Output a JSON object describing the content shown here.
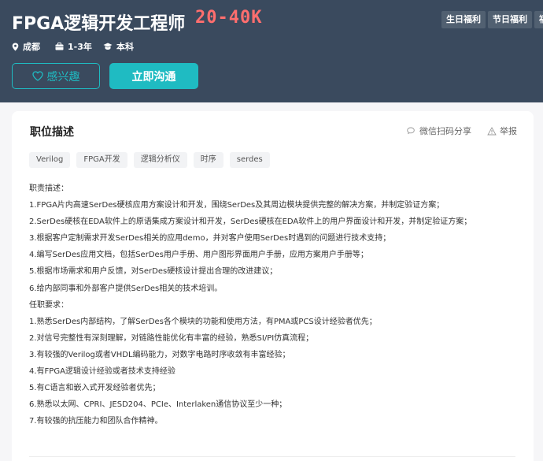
{
  "job": {
    "title": "FPGA逻辑开发工程师",
    "salary": "20-40K",
    "location": "成都",
    "experience": "1-3年",
    "degree": "本科"
  },
  "welfare_tags": [
    "生日福利",
    "节日福利",
    "福"
  ],
  "actions": {
    "interest_label": "感兴趣",
    "chat_label": "立即沟通"
  },
  "section": {
    "title": "职位描述",
    "share_label": "微信扫码分享",
    "report_label": "举报"
  },
  "skill_tags": [
    "Verilog",
    "FPGA开发",
    "逻辑分析仪",
    "时序",
    "serdes"
  ],
  "description_lines": [
    "职责描述：",
    "1.FPGA片内高速SerDes硬核应用方案设计和开发，围绕SerDes及其周边模块提供完整的解决方案，并制定验证方案；",
    "2.SerDes硬核在EDA软件上的原语集成方案设计和开发，SerDes硬核在EDA软件上的用户界面设计和开发，并制定验证方案；",
    "3.根据客户定制需求开发SerDes相关的应用demo，并对客户使用SerDes时遇到的问题进行技术支持；",
    "4.编写SerDes应用文档，包括SerDes用户手册、用户图形界面用户手册，应用方案用户手册等；",
    "5.根据市场需求和用户反馈，对SerDes硬核设计提出合理的改进建议；",
    "6.给内部同事和外部客户提供SerDes相关的技术培训。",
    "任职要求：",
    "1.熟悉SerDes内部结构，了解SerDes各个模块的功能和使用方法，有PMA或PCS设计经验者优先；",
    "2.对信号完整性有深刻理解，对链路性能优化有丰富的经验，熟悉SI/PI仿真流程；",
    "3.有较强的Verilog或者VHDL编码能力，对数字电路时序收敛有丰富经验；",
    "4.有FPGA逻辑设计经验或者技术支持经验",
    "5.有C语言和嵌入式开发经验者优先；",
    "6.熟悉以太网、CPRI、JESD204、PCIe、Interlaken通信协议至少一种；",
    "7.有较强的抗压能力和团队合作精神。"
  ],
  "colors": {
    "header_bg": "#3a4a5e",
    "accent": "#1fbbc2",
    "salary": "#ff6e6e"
  }
}
